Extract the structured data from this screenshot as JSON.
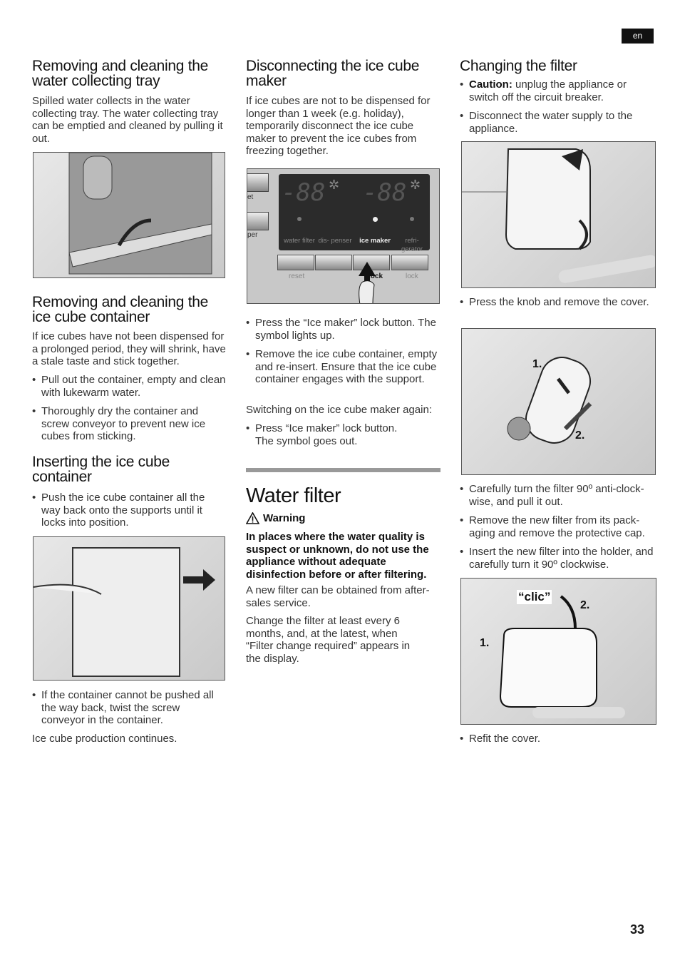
{
  "lang": "en",
  "page_number": "33",
  "col1": {
    "s1": {
      "title": "Removing and cleaning the water collecting tray",
      "text": "Spilled water collects in the water collecting tray. The water collecting tray can be emptied and cleaned by pulling it out."
    },
    "s2": {
      "title": "Removing and cleaning the ice cube container",
      "text": "If ice cubes have not been dispensed for a prolonged period, they will shrink, have a stale taste and stick together.",
      "bullets": [
        "Pull out the container, empty and clean with lukewarm water.",
        "Thoroughly dry the container and screw conveyor to prevent new ice cubes from sticking."
      ]
    },
    "s3": {
      "title": "Inserting the ice cube container",
      "bullets": [
        "Push the ice cube container all the way back onto the supports until it locks into position."
      ],
      "bullets2": [
        "If the container cannot be pushed all the way back, twist the screw conveyor in the container."
      ],
      "text": "Ice cube production continues."
    }
  },
  "col2": {
    "s1": {
      "title": "Disconnecting the ice cube maker",
      "text": "If ice cubes are not to be dispensed for longer than 1 week (e.g. holiday), temporarily disconnect the ice cube maker to prevent the ice cubes from freezing together.",
      "panel": {
        "digits": "-88",
        "degree": "°",
        "side_labels": [
          "et",
          "per"
        ],
        "labels": [
          "water filter",
          "dis- penser",
          "ice maker",
          "refri- gerator"
        ],
        "buttons": [
          "reset",
          "lock",
          "lock"
        ]
      },
      "bullets": [
        "Press the “Ice maker” lock button. The symbol lights up.",
        "Remove the ice cube container, empty and re-insert. Ensure that the ice cube container engages with the support."
      ],
      "text2": "Switching on the ice cube maker again:",
      "bullets2": [
        "Press “Ice maker” lock button. The symbol goes out."
      ]
    },
    "water_filter": {
      "title": "Water filter",
      "warning_label": "Warning",
      "warning_text": "In places where the water quality is suspect or unknown, do not use the appliance without adequate disinfection before or after filtering.",
      "p1": "A new filter can be obtained from after-sales service.",
      "p2": "Change the filter at least every 6 months, and, at the latest, when “Filter change required” appears in the display."
    }
  },
  "col3": {
    "title": "Changing the filter",
    "caution_label": "Caution:",
    "caution_text": " unplug the appliance or switch off the circuit breaker.",
    "b2": "Disconnect the water supply to the appliance.",
    "b3": "Press the knob and remove the cover.",
    "b4": [
      "Carefully turn the filter 90º anti-clock-wise, and pull it out.",
      "Remove the new filter from its pack-aging and remove the protective cap.",
      "Insert the new filter into the holder, and carefully turn it 90º clockwise."
    ],
    "b5": "Refit the cover.",
    "img2_steps": [
      "1.",
      "2."
    ],
    "img3_steps": [
      "1.",
      "2."
    ],
    "img3_sound": "“clic”"
  }
}
